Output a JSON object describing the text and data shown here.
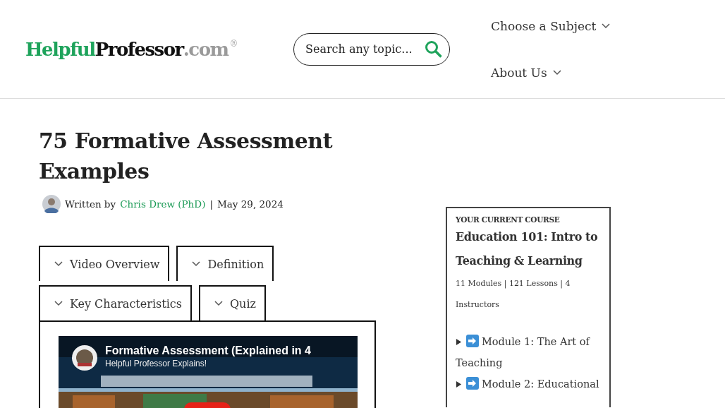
{
  "header": {
    "logo": {
      "part_1": "Helpful",
      "part_2": "Professor",
      "part_3": ".com",
      "mark": "®"
    },
    "search": {
      "placeholder": "Search any topic..."
    },
    "nav": [
      {
        "label": "Choose a Subject"
      },
      {
        "label": "About Us"
      }
    ]
  },
  "article": {
    "title": "75 Formative Assessment Examples",
    "byline": {
      "prefix": "Written by",
      "author": "Chris Drew (PhD)",
      "separator": "|",
      "date": "May 29, 2024"
    },
    "tabs": [
      {
        "label": "Video Overview"
      },
      {
        "label": "Definition"
      },
      {
        "label": "Key Characteristics"
      },
      {
        "label": "Quiz"
      }
    ],
    "video": {
      "kind": "picture",
      "title": "Formative Assessment (Explained in 4",
      "channel": "Helpful Professor Explains!"
    }
  },
  "sidebar": {
    "eyebrow": "YOUR CURRENT COURSE",
    "course_title": "Education 101: Intro to Teaching & Learning",
    "meta": "11 Modules | 121 Lessons | 4 Instructors",
    "modules": [
      {
        "label": "Module 1: The Art of Teaching",
        "expanded": false
      },
      {
        "label": "Module 2: Educational",
        "expanded": false
      }
    ]
  }
}
